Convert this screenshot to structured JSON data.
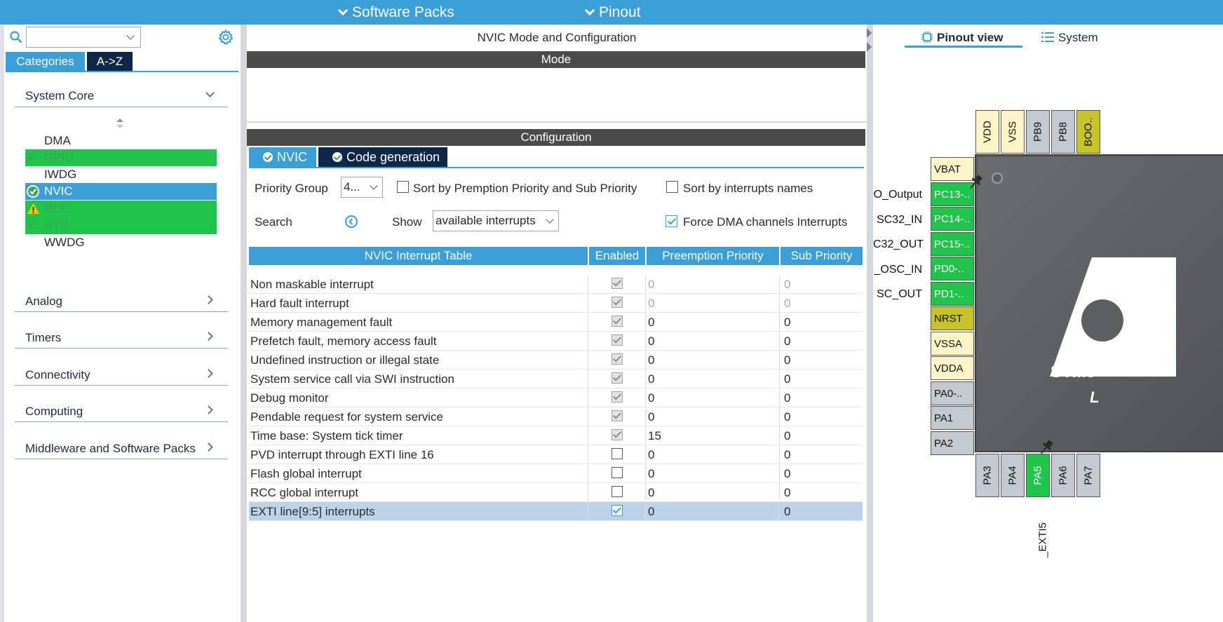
{
  "topbar": {
    "software_packs": "Software Packs",
    "pinout": "Pinout"
  },
  "left": {
    "search_placeholder": "",
    "tabs": {
      "categories": "Categories",
      "az": "A->Z"
    },
    "system_core": "System Core",
    "core_items": [
      {
        "label": "DMA",
        "status": "none"
      },
      {
        "label": "GPIO",
        "status": "ok"
      },
      {
        "label": "IWDG",
        "status": "none"
      },
      {
        "label": "NVIC",
        "status": "ok-selected"
      },
      {
        "label": "RCC",
        "status": "warning"
      },
      {
        "label": "SYS",
        "status": "ok"
      },
      {
        "label": "WWDG",
        "status": "none"
      }
    ],
    "sections": [
      "Analog",
      "Timers",
      "Connectivity",
      "Computing",
      "Middleware and Software Packs"
    ]
  },
  "middle": {
    "title": "NVIC Mode and Configuration",
    "mode_label": "Mode",
    "config_label": "Configuration",
    "tabs": {
      "nvic": "NVIC",
      "codegen": "Code generation"
    },
    "priority_group_label": "Priority Group",
    "priority_group_value": "4...",
    "sort_preemption": "Sort by Premption Priority and Sub Priority",
    "sort_preemption_checked": false,
    "sort_names": "Sort by interrupts names",
    "sort_names_checked": false,
    "search_label": "Search",
    "show_label": "Show",
    "show_value": "available interrupts",
    "force_dma": "Force DMA channels Interrupts",
    "force_dma_checked": true,
    "table": {
      "headers": [
        "NVIC Interrupt Table",
        "Enabled",
        "Preemption Priority",
        "Sub Priority"
      ],
      "rows": [
        {
          "name": "Non maskable interrupt",
          "enabled": "locked",
          "pre": "0",
          "sub": "0",
          "grey": true
        },
        {
          "name": "Hard fault interrupt",
          "enabled": "locked",
          "pre": "0",
          "sub": "0",
          "grey": true
        },
        {
          "name": "Memory management fault",
          "enabled": "locked",
          "pre": "0",
          "sub": "0"
        },
        {
          "name": "Prefetch fault, memory access fault",
          "enabled": "locked",
          "pre": "0",
          "sub": "0"
        },
        {
          "name": "Undefined instruction or illegal state",
          "enabled": "locked",
          "pre": "0",
          "sub": "0"
        },
        {
          "name": "System service call via SWI instruction",
          "enabled": "locked",
          "pre": "0",
          "sub": "0"
        },
        {
          "name": "Debug monitor",
          "enabled": "locked",
          "pre": "0",
          "sub": "0"
        },
        {
          "name": "Pendable request for system service",
          "enabled": "locked",
          "pre": "0",
          "sub": "0"
        },
        {
          "name": "Time base: System tick timer",
          "enabled": "locked",
          "pre": "15",
          "sub": "0"
        },
        {
          "name": "PVD interrupt through EXTI line 16",
          "enabled": "off",
          "pre": "0",
          "sub": "0"
        },
        {
          "name": "Flash global interrupt",
          "enabled": "off",
          "pre": "0",
          "sub": "0"
        },
        {
          "name": "RCC global interrupt",
          "enabled": "off",
          "pre": "0",
          "sub": "0"
        },
        {
          "name": "EXTI line[9:5] interrupts",
          "enabled": "on",
          "pre": "0",
          "sub": "0",
          "selected": true
        }
      ]
    }
  },
  "right": {
    "tabs": {
      "pinout_view": "Pinout view",
      "system": "System"
    },
    "top_pins": [
      "VDD",
      "VSS",
      "PB9",
      "PB8",
      "BOO.."
    ],
    "left_pins": [
      "VBAT",
      "PC13-..",
      "PC14-..",
      "PC15-..",
      "PD0-..",
      "PD1-..",
      "NRST",
      "VSSA",
      "VDDA",
      "PA0-..",
      "PA1",
      "PA2"
    ],
    "left_signals": [
      "O_Output",
      "SC32_IN",
      "C32_OUT",
      "_OSC_IN",
      "SC_OUT"
    ],
    "bottom_pins": [
      "PA3",
      "PA4",
      "PA5",
      "PA6",
      "PA7"
    ],
    "bottom_signal": "_EXTI5",
    "chip_name": "STM3",
    "chip_sub": "L"
  },
  "colors": {
    "accent": "#3a9fd6",
    "dark_bar": "#4b4b4b",
    "ok_green": "#3aa35f",
    "pin_green": "#21c44a",
    "pin_cream": "#fff4c8",
    "pin_gray": "#c2cad0",
    "pin_olive": "#c5c52a",
    "warning": "#f5c400"
  }
}
